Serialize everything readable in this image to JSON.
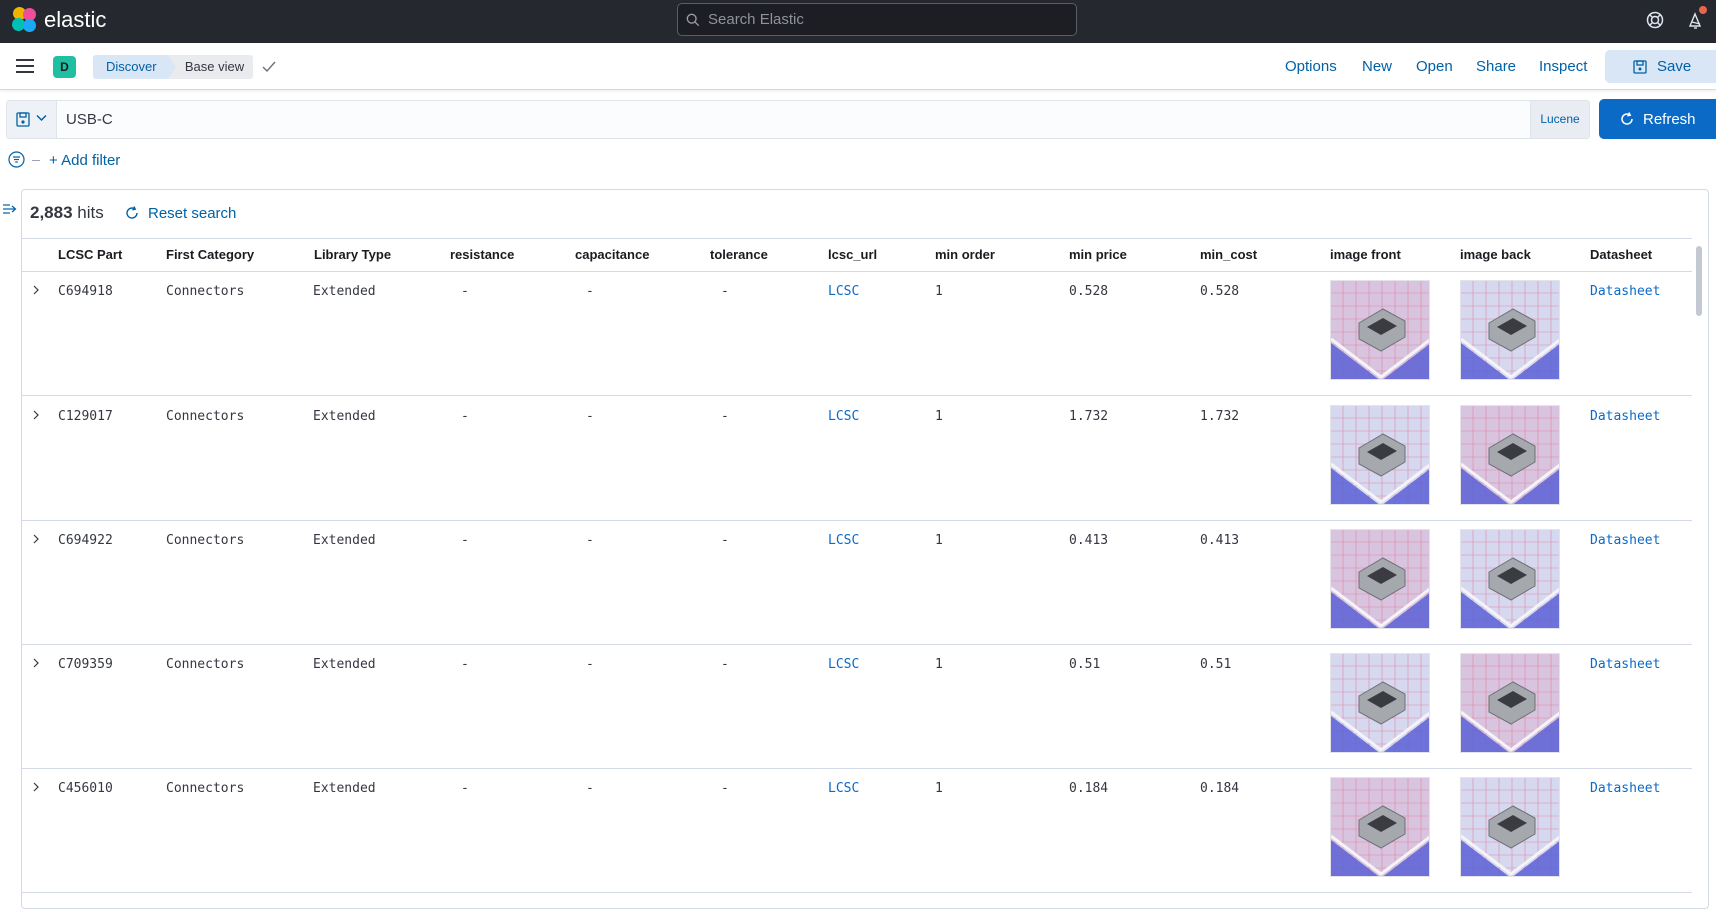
{
  "header": {
    "app_name": "elastic",
    "search_placeholder": "Search Elastic"
  },
  "appbar": {
    "space_initial": "D",
    "breadcrumbs": [
      "Discover",
      "Base view"
    ],
    "nav": {
      "options": "Options",
      "new": "New",
      "open": "Open",
      "share": "Share",
      "inspect": "Inspect",
      "save": "Save"
    }
  },
  "query": {
    "value": "USB-C",
    "language": "Lucene",
    "refresh_label": "Refresh"
  },
  "filters": {
    "add_filter_label": "+ Add filter"
  },
  "results": {
    "hits_count": "2,883",
    "hits_label": "hits",
    "reset_label": "Reset search",
    "columns": [
      "LCSC Part",
      "First Category",
      "Library Type",
      "resistance",
      "capacitance",
      "tolerance",
      "lcsc_url",
      "min order",
      "min price",
      "min_cost",
      "image front",
      "image back",
      "Datasheet"
    ],
    "rows": [
      {
        "part": "C694918",
        "category": "Connectors",
        "library": "Extended",
        "resistance": "-",
        "capacitance": "-",
        "tolerance": "-",
        "url": "LCSC",
        "min_order": "1",
        "min_price": "0.528",
        "min_cost": "0.528",
        "datasheet": "Datasheet"
      },
      {
        "part": "C129017",
        "category": "Connectors",
        "library": "Extended",
        "resistance": "-",
        "capacitance": "-",
        "tolerance": "-",
        "url": "LCSC",
        "min_order": "1",
        "min_price": "1.732",
        "min_cost": "1.732",
        "datasheet": "Datasheet"
      },
      {
        "part": "C694922",
        "category": "Connectors",
        "library": "Extended",
        "resistance": "-",
        "capacitance": "-",
        "tolerance": "-",
        "url": "LCSC",
        "min_order": "1",
        "min_price": "0.413",
        "min_cost": "0.413",
        "datasheet": "Datasheet"
      },
      {
        "part": "C709359",
        "category": "Connectors",
        "library": "Extended",
        "resistance": "-",
        "capacitance": "-",
        "tolerance": "-",
        "url": "LCSC",
        "min_order": "1",
        "min_price": "0.51",
        "min_cost": "0.51",
        "datasheet": "Datasheet"
      },
      {
        "part": "C456010",
        "category": "Connectors",
        "library": "Extended",
        "resistance": "-",
        "capacitance": "-",
        "tolerance": "-",
        "url": "LCSC",
        "min_order": "1",
        "min_price": "0.184",
        "min_cost": "0.184",
        "datasheet": "Datasheet"
      }
    ]
  },
  "colors": {
    "topbar": "#25282f",
    "primary": "#0b6ac6",
    "link": "#0061a6",
    "space_avatar": "#20bfa1"
  }
}
